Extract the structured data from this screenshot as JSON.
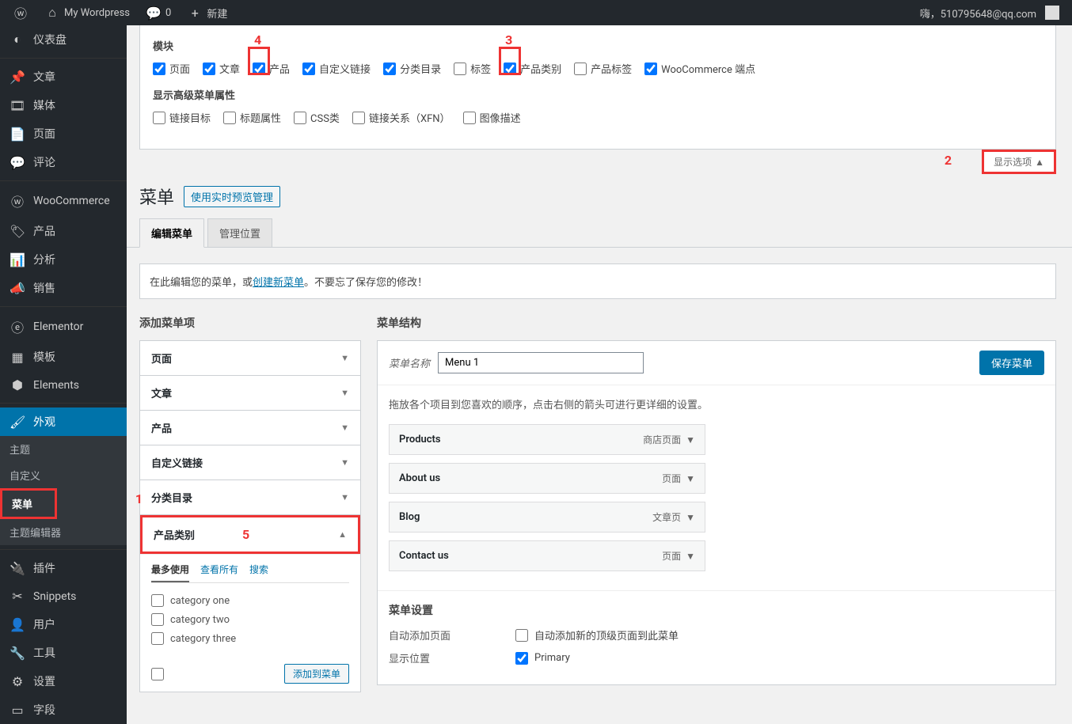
{
  "topbar": {
    "site_name": "My Wordpress",
    "comments": "0",
    "new": "新建",
    "greeting": "嗨，510795648@qq.com"
  },
  "sidebar": {
    "items": [
      {
        "label": "仪表盘",
        "icon": "◐"
      },
      {
        "label": "文章",
        "icon": "📌"
      },
      {
        "label": "媒体",
        "icon": "🎞"
      },
      {
        "label": "页面",
        "icon": "📄"
      },
      {
        "label": "评论",
        "icon": "💬"
      },
      {
        "label": "WooCommerce",
        "icon": "ⓦ"
      },
      {
        "label": "产品",
        "icon": "🏷"
      },
      {
        "label": "分析",
        "icon": "📊"
      },
      {
        "label": "销售",
        "icon": "📣"
      },
      {
        "label": "Elementor",
        "icon": "ⓔ"
      },
      {
        "label": "模板",
        "icon": "▦"
      },
      {
        "label": "Elements",
        "icon": "⬢"
      },
      {
        "label": "外观",
        "icon": "🖌"
      },
      {
        "label": "插件",
        "icon": "🔌"
      },
      {
        "label": "Snippets",
        "icon": "✂"
      },
      {
        "label": "用户",
        "icon": "👤"
      },
      {
        "label": "工具",
        "icon": "🔧"
      },
      {
        "label": "设置",
        "icon": "⚙"
      },
      {
        "label": "字段",
        "icon": "▭"
      }
    ],
    "appearance_sub": [
      "主题",
      "自定义",
      "菜单",
      "主题编辑器"
    ]
  },
  "screen_options": {
    "modules_title": "模块",
    "modules": [
      {
        "label": "页面",
        "checked": true
      },
      {
        "label": "文章",
        "checked": true
      },
      {
        "label": "产品",
        "checked": true
      },
      {
        "label": "自定义链接",
        "checked": true
      },
      {
        "label": "分类目录",
        "checked": true
      },
      {
        "label": "标签",
        "checked": false
      },
      {
        "label": "产品类别",
        "checked": true
      },
      {
        "label": "产品标签",
        "checked": false
      },
      {
        "label": "WooCommerce 端点",
        "checked": true
      }
    ],
    "advanced_title": "显示高级菜单属性",
    "advanced": [
      {
        "label": "链接目标",
        "checked": false
      },
      {
        "label": "标题属性",
        "checked": false
      },
      {
        "label": "CSS类",
        "checked": false
      },
      {
        "label": "链接关系（XFN）",
        "checked": false
      },
      {
        "label": "图像描述",
        "checked": false
      }
    ],
    "toggle_label": "显示选项"
  },
  "page": {
    "title": "菜单",
    "live_preview": "使用实时预览管理",
    "tabs": {
      "edit": "编辑菜单",
      "locations": "管理位置"
    },
    "notice_before": "在此编辑您的菜单，或",
    "notice_link": "创建新菜单",
    "notice_after": "。不要忘了保存您的修改！"
  },
  "add_panel": {
    "title": "添加菜单项",
    "sections": [
      "页面",
      "文章",
      "产品",
      "自定义链接",
      "分类目录",
      "产品类别"
    ],
    "cat_tabs": {
      "recent": "最多使用",
      "all": "查看所有",
      "search": "搜索"
    },
    "categories": [
      "category one",
      "category two",
      "category three"
    ],
    "add_btn": "添加到菜单"
  },
  "structure": {
    "title": "菜单结构",
    "name_label": "菜单名称",
    "name_value": "Menu 1",
    "save": "保存菜单",
    "hint": "拖放各个项目到您喜欢的顺序，点击右侧的箭头可进行更详细的设置。",
    "items": [
      {
        "title": "Products",
        "type": "商店页面"
      },
      {
        "title": "About us",
        "type": "页面"
      },
      {
        "title": "Blog",
        "type": "文章页"
      },
      {
        "title": "Contact us",
        "type": "页面"
      }
    ],
    "settings": {
      "title": "菜单设置",
      "auto_label": "自动添加页面",
      "auto_text": "自动添加新的顶级页面到此菜单",
      "loc_label": "显示位置",
      "loc_text": "Primary"
    }
  },
  "annotations": {
    "1": "1",
    "2": "2",
    "3": "3",
    "4": "4",
    "5": "5"
  }
}
